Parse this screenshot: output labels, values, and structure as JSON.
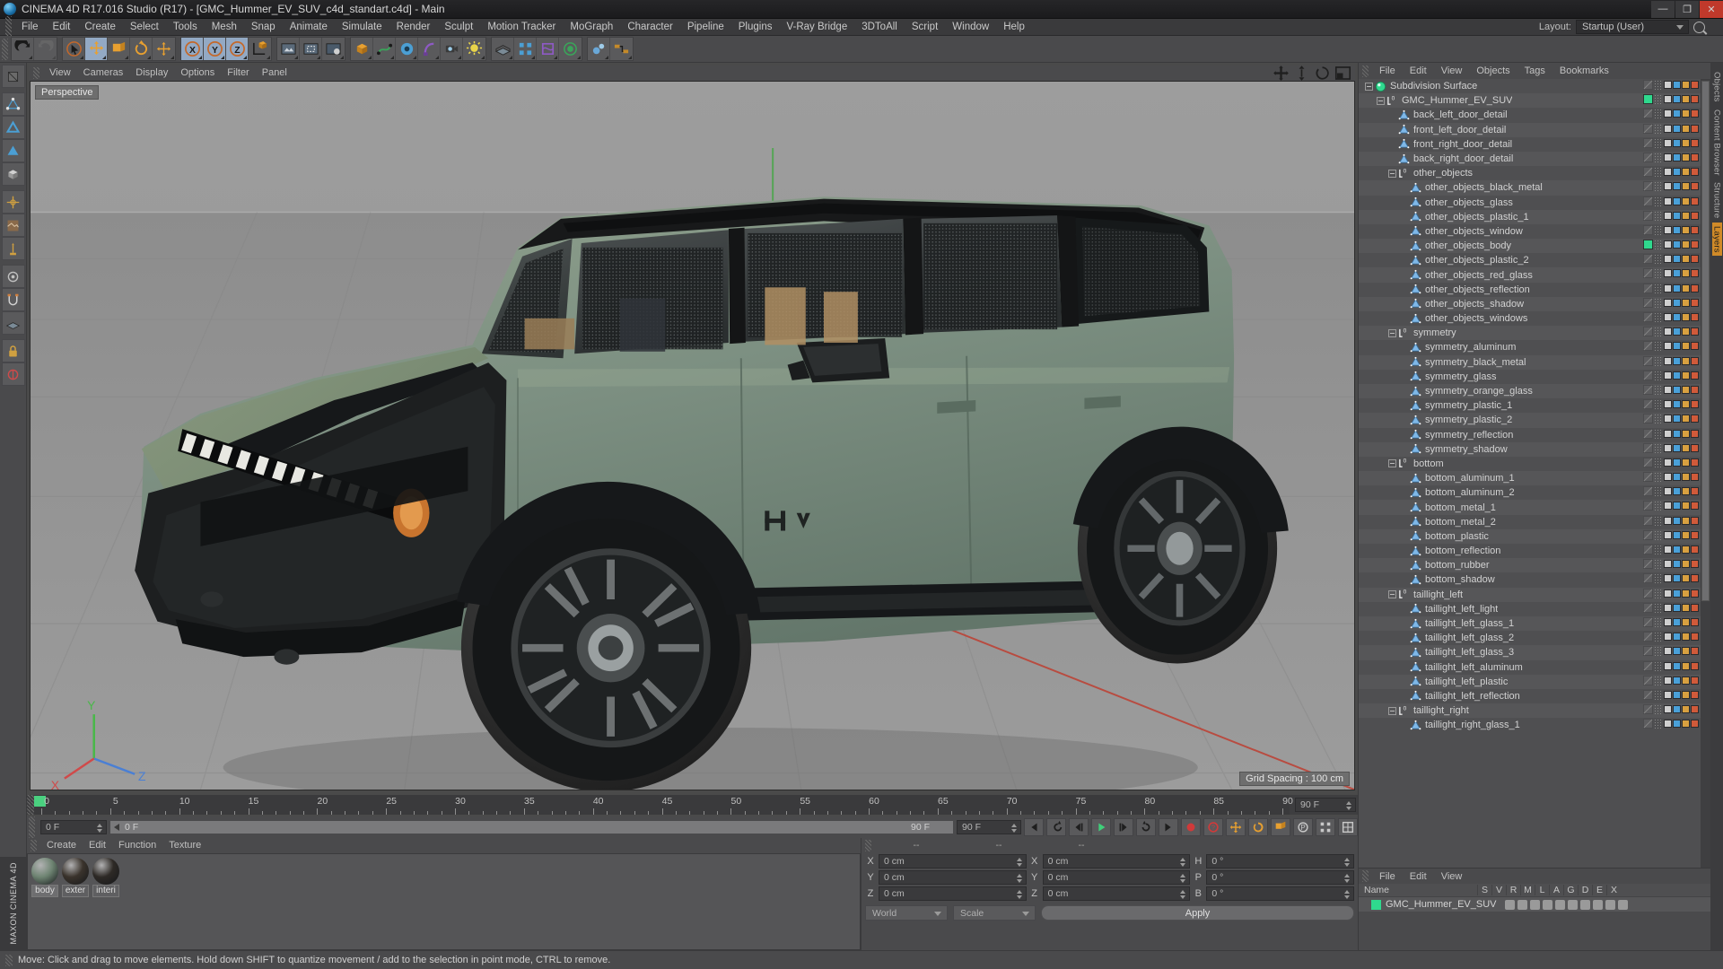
{
  "titlebar": {
    "title": "CINEMA 4D R17.016 Studio (R17) - [GMC_Hummer_EV_SUV_c4d_standart.c4d] - Main",
    "minimize": "—",
    "maximize": "❐",
    "close": "✕"
  },
  "menubar": {
    "items": [
      "File",
      "Edit",
      "Create",
      "Select",
      "Tools",
      "Mesh",
      "Snap",
      "Animate",
      "Simulate",
      "Render",
      "Sculpt",
      "Motion Tracker",
      "MoGraph",
      "Character",
      "Pipeline",
      "Plugins",
      "V-Ray Bridge",
      "3DToAll",
      "Script",
      "Window",
      "Help"
    ],
    "layout_label": "Layout:",
    "layout_value": "Startup (User)"
  },
  "viewport": {
    "menus": [
      "View",
      "Cameras",
      "Display",
      "Options",
      "Filter",
      "Panel"
    ],
    "perspective_tag": "Perspective",
    "grid_spacing": "Grid Spacing : 100 cm",
    "axis_labels": {
      "x": "X",
      "y": "Y",
      "z": "Z"
    }
  },
  "timeline": {
    "ticks": [
      0,
      5,
      10,
      15,
      20,
      25,
      30,
      35,
      40,
      45,
      50,
      55,
      60,
      65,
      70,
      75,
      80,
      85,
      90
    ],
    "current_frame": "0 F",
    "start_frame": "0 F",
    "end_frame": "90 F",
    "preview_end": "90 F"
  },
  "materials": {
    "menus": [
      "Create",
      "Edit",
      "Function",
      "Texture"
    ],
    "items": [
      {
        "name": "body",
        "color": "#6e8472"
      },
      {
        "name": "exter",
        "color": "#3a332c"
      },
      {
        "name": "interi",
        "color": "#2e2a26"
      }
    ]
  },
  "coordinates": {
    "headers": [
      "--",
      "--",
      "--"
    ],
    "position": {
      "label_x": "X",
      "label_y": "Y",
      "label_z": "Z",
      "x": "0 cm",
      "y": "0 cm",
      "z": "0 cm"
    },
    "size": {
      "label_x": "X",
      "label_y": "Y",
      "label_z": "Z",
      "x": "0 cm",
      "y": "0 cm",
      "z": "0 cm"
    },
    "rotation": {
      "label_h": "H",
      "label_p": "P",
      "label_b": "B",
      "h": "0 °",
      "p": "0 °",
      "b": "0 °"
    },
    "system": "World",
    "mode": "Scale",
    "apply": "Apply"
  },
  "object_manager": {
    "menus": [
      "File",
      "Edit",
      "View",
      "Objects",
      "Tags",
      "Bookmarks"
    ],
    "items": [
      {
        "label": "Subdivision Surface",
        "depth": 0,
        "icon": "subdivision",
        "twirl": true,
        "swatch": null
      },
      {
        "label": "GMC_Hummer_EV_SUV",
        "depth": 1,
        "icon": "null",
        "twirl": true,
        "swatch": "#2fd98e"
      },
      {
        "label": "back_left_door_detail",
        "depth": 2,
        "icon": "polygon",
        "twirl": false,
        "swatch": null
      },
      {
        "label": "front_left_door_detail",
        "depth": 2,
        "icon": "polygon",
        "twirl": false,
        "swatch": null
      },
      {
        "label": "front_right_door_detail",
        "depth": 2,
        "icon": "polygon",
        "twirl": false,
        "swatch": null
      },
      {
        "label": "back_right_door_detail",
        "depth": 2,
        "icon": "polygon",
        "twirl": false,
        "swatch": null
      },
      {
        "label": "other_objects",
        "depth": 2,
        "icon": "null",
        "twirl": true,
        "swatch": null
      },
      {
        "label": "other_objects_black_metal",
        "depth": 3,
        "icon": "polygon",
        "twirl": false,
        "swatch": null
      },
      {
        "label": "other_objects_glass",
        "depth": 3,
        "icon": "polygon",
        "twirl": false,
        "swatch": null
      },
      {
        "label": "other_objects_plastic_1",
        "depth": 3,
        "icon": "polygon",
        "twirl": false,
        "swatch": null
      },
      {
        "label": "other_objects_window",
        "depth": 3,
        "icon": "polygon",
        "twirl": false,
        "swatch": null
      },
      {
        "label": "other_objects_body",
        "depth": 3,
        "icon": "polygon",
        "twirl": false,
        "swatch": "#2fd98e"
      },
      {
        "label": "other_objects_plastic_2",
        "depth": 3,
        "icon": "polygon",
        "twirl": false,
        "swatch": null
      },
      {
        "label": "other_objects_red_glass",
        "depth": 3,
        "icon": "polygon",
        "twirl": false,
        "swatch": null
      },
      {
        "label": "other_objects_reflection",
        "depth": 3,
        "icon": "polygon",
        "twirl": false,
        "swatch": null
      },
      {
        "label": "other_objects_shadow",
        "depth": 3,
        "icon": "polygon",
        "twirl": false,
        "swatch": null
      },
      {
        "label": "other_objects_windows",
        "depth": 3,
        "icon": "polygon",
        "twirl": false,
        "swatch": null
      },
      {
        "label": "symmetry",
        "depth": 2,
        "icon": "null",
        "twirl": true,
        "swatch": null
      },
      {
        "label": "symmetry_aluminum",
        "depth": 3,
        "icon": "polygon",
        "twirl": false,
        "swatch": null
      },
      {
        "label": "symmetry_black_metal",
        "depth": 3,
        "icon": "polygon",
        "twirl": false,
        "swatch": null
      },
      {
        "label": "symmetry_glass",
        "depth": 3,
        "icon": "polygon",
        "twirl": false,
        "swatch": null
      },
      {
        "label": "symmetry_orange_glass",
        "depth": 3,
        "icon": "polygon",
        "twirl": false,
        "swatch": null
      },
      {
        "label": "symmetry_plastic_1",
        "depth": 3,
        "icon": "polygon",
        "twirl": false,
        "swatch": null
      },
      {
        "label": "symmetry_plastic_2",
        "depth": 3,
        "icon": "polygon",
        "twirl": false,
        "swatch": null
      },
      {
        "label": "symmetry_reflection",
        "depth": 3,
        "icon": "polygon",
        "twirl": false,
        "swatch": null
      },
      {
        "label": "symmetry_shadow",
        "depth": 3,
        "icon": "polygon",
        "twirl": false,
        "swatch": null
      },
      {
        "label": "bottom",
        "depth": 2,
        "icon": "null",
        "twirl": true,
        "swatch": null
      },
      {
        "label": "bottom_aluminum_1",
        "depth": 3,
        "icon": "polygon",
        "twirl": false,
        "swatch": null
      },
      {
        "label": "bottom_aluminum_2",
        "depth": 3,
        "icon": "polygon",
        "twirl": false,
        "swatch": null
      },
      {
        "label": "bottom_metal_1",
        "depth": 3,
        "icon": "polygon",
        "twirl": false,
        "swatch": null
      },
      {
        "label": "bottom_metal_2",
        "depth": 3,
        "icon": "polygon",
        "twirl": false,
        "swatch": null
      },
      {
        "label": "bottom_plastic",
        "depth": 3,
        "icon": "polygon",
        "twirl": false,
        "swatch": null
      },
      {
        "label": "bottom_reflection",
        "depth": 3,
        "icon": "polygon",
        "twirl": false,
        "swatch": null
      },
      {
        "label": "bottom_rubber",
        "depth": 3,
        "icon": "polygon",
        "twirl": false,
        "swatch": null
      },
      {
        "label": "bottom_shadow",
        "depth": 3,
        "icon": "polygon",
        "twirl": false,
        "swatch": null
      },
      {
        "label": "taillight_left",
        "depth": 2,
        "icon": "null",
        "twirl": true,
        "swatch": null
      },
      {
        "label": "taillight_left_light",
        "depth": 3,
        "icon": "polygon",
        "twirl": false,
        "swatch": null
      },
      {
        "label": "taillight_left_glass_1",
        "depth": 3,
        "icon": "polygon",
        "twirl": false,
        "swatch": null
      },
      {
        "label": "taillight_left_glass_2",
        "depth": 3,
        "icon": "polygon",
        "twirl": false,
        "swatch": null
      },
      {
        "label": "taillight_left_glass_3",
        "depth": 3,
        "icon": "polygon",
        "twirl": false,
        "swatch": null
      },
      {
        "label": "taillight_left_aluminum",
        "depth": 3,
        "icon": "polygon",
        "twirl": false,
        "swatch": null
      },
      {
        "label": "taillight_left_plastic",
        "depth": 3,
        "icon": "polygon",
        "twirl": false,
        "swatch": null
      },
      {
        "label": "taillight_left_reflection",
        "depth": 3,
        "icon": "polygon",
        "twirl": false,
        "swatch": null
      },
      {
        "label": "taillight_right",
        "depth": 2,
        "icon": "null",
        "twirl": true,
        "swatch": null
      },
      {
        "label": "taillight_right_glass_1",
        "depth": 3,
        "icon": "polygon",
        "twirl": false,
        "swatch": null
      }
    ]
  },
  "layer_manager": {
    "menus": [
      "File",
      "Edit",
      "View"
    ],
    "columns": [
      "Name",
      "S",
      "V",
      "R",
      "M",
      "L",
      "A",
      "G",
      "D",
      "E",
      "X"
    ],
    "rows": [
      {
        "name": "GMC_Hummer_EV_SUV",
        "swatch": "#2fd98e"
      }
    ]
  },
  "right_tabs": [
    "Objects",
    "Content Browser",
    "Structure",
    "Layers"
  ],
  "status": {
    "message": "Move: Click and drag to move elements. Hold down SHIFT to quantize movement / add to the selection in point mode, CTRL to remove."
  },
  "branding": {
    "text": "MAXON CINEMA 4D"
  },
  "toolbar": {
    "groups": [
      {
        "buttons": [
          {
            "name": "undo-icon",
            "sel": false,
            "dim": false
          },
          {
            "name": "redo-icon",
            "sel": false,
            "dim": true
          }
        ]
      },
      {
        "buttons": [
          {
            "name": "select-tool-icon",
            "sel": false,
            "dim": false
          },
          {
            "name": "move-tool-icon",
            "sel": true,
            "dim": false
          },
          {
            "name": "scale-tool-icon",
            "sel": false,
            "dim": false
          },
          {
            "name": "rotate-tool-icon",
            "sel": false,
            "dim": false
          },
          {
            "name": "move-alt-icon",
            "sel": false,
            "dim": false
          }
        ]
      },
      {
        "buttons": [
          {
            "name": "axis-x-icon",
            "sel": true,
            "dim": false
          },
          {
            "name": "axis-y-icon",
            "sel": true,
            "dim": false
          },
          {
            "name": "axis-z-icon",
            "sel": true,
            "dim": false
          },
          {
            "name": "world-coord-icon",
            "sel": false,
            "dim": false
          }
        ]
      },
      {
        "buttons": [
          {
            "name": "render-view-icon",
            "sel": false,
            "dim": false
          },
          {
            "name": "render-region-icon",
            "sel": false,
            "dim": false
          },
          {
            "name": "render-settings-icon",
            "sel": false,
            "dim": false
          }
        ]
      },
      {
        "buttons": [
          {
            "name": "cube-primitive-icon",
            "sel": false,
            "dim": false
          },
          {
            "name": "spline-pen-icon",
            "sel": false,
            "dim": false
          },
          {
            "name": "generator-icon",
            "sel": false,
            "dim": false
          },
          {
            "name": "bend-deformer-icon",
            "sel": false,
            "dim": false
          },
          {
            "name": "camera-icon",
            "sel": false,
            "dim": false
          },
          {
            "name": "light-icon",
            "sel": false,
            "dim": false
          }
        ]
      },
      {
        "buttons": [
          {
            "name": "floor-icon",
            "sel": false,
            "dim": false
          },
          {
            "name": "mograph-icon",
            "sel": false,
            "dim": false
          },
          {
            "name": "deformer-icon",
            "sel": false,
            "dim": false
          },
          {
            "name": "field-icon",
            "sel": false,
            "dim": false
          }
        ]
      },
      {
        "buttons": [
          {
            "name": "simulate-icon",
            "sel": false,
            "dim": false
          },
          {
            "name": "xpresso-icon",
            "sel": false,
            "dim": false
          }
        ]
      }
    ]
  },
  "left_toolbar": {
    "buttons": [
      {
        "name": "texture-axis-icon",
        "sel": false
      },
      {
        "name": "point-mode-icon",
        "sel": false
      },
      {
        "name": "edge-mode-icon",
        "sel": false
      },
      {
        "name": "polygon-mode-icon",
        "sel": false
      },
      {
        "name": "model-mode-icon",
        "sel": false
      },
      {
        "name": "object-axis-icon",
        "sel": false
      },
      {
        "name": "texture-mode-icon",
        "sel": false
      },
      {
        "name": "enable-axis-icon",
        "sel": false
      },
      {
        "name": "viewport-solo-icon",
        "sel": false
      },
      {
        "name": "snap-icon",
        "sel": false
      },
      {
        "name": "workplane-icon",
        "sel": false
      },
      {
        "name": "lock-icon",
        "sel": false
      },
      {
        "name": "modeling-axis-icon",
        "sel": false
      }
    ]
  },
  "playback": {
    "buttons": [
      "go-to-start",
      "play-reverse",
      "step-back",
      "play",
      "step-forward",
      "loop",
      "go-to-end",
      "record",
      "autokey",
      "key-position",
      "key-rotation",
      "key-scale",
      "key-param",
      "key-point",
      "key-all"
    ]
  }
}
